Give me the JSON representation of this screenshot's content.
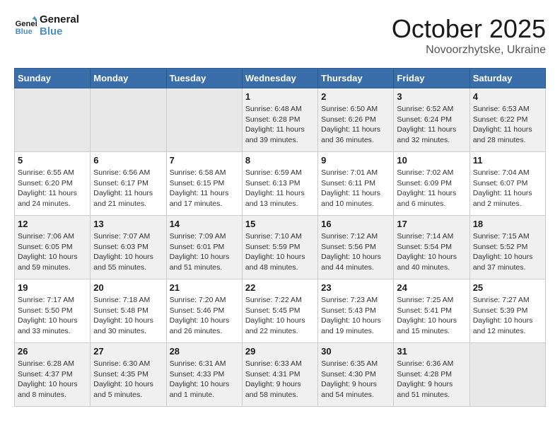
{
  "logo": {
    "line1": "General",
    "line2": "Blue"
  },
  "title": "October 2025",
  "subtitle": "Novoorzhytske, Ukraine",
  "weekdays": [
    "Sunday",
    "Monday",
    "Tuesday",
    "Wednesday",
    "Thursday",
    "Friday",
    "Saturday"
  ],
  "weeks": [
    [
      {
        "day": "",
        "info": ""
      },
      {
        "day": "",
        "info": ""
      },
      {
        "day": "",
        "info": ""
      },
      {
        "day": "1",
        "info": "Sunrise: 6:48 AM\nSunset: 6:28 PM\nDaylight: 11 hours\nand 39 minutes."
      },
      {
        "day": "2",
        "info": "Sunrise: 6:50 AM\nSunset: 6:26 PM\nDaylight: 11 hours\nand 36 minutes."
      },
      {
        "day": "3",
        "info": "Sunrise: 6:52 AM\nSunset: 6:24 PM\nDaylight: 11 hours\nand 32 minutes."
      },
      {
        "day": "4",
        "info": "Sunrise: 6:53 AM\nSunset: 6:22 PM\nDaylight: 11 hours\nand 28 minutes."
      }
    ],
    [
      {
        "day": "5",
        "info": "Sunrise: 6:55 AM\nSunset: 6:20 PM\nDaylight: 11 hours\nand 24 minutes."
      },
      {
        "day": "6",
        "info": "Sunrise: 6:56 AM\nSunset: 6:17 PM\nDaylight: 11 hours\nand 21 minutes."
      },
      {
        "day": "7",
        "info": "Sunrise: 6:58 AM\nSunset: 6:15 PM\nDaylight: 11 hours\nand 17 minutes."
      },
      {
        "day": "8",
        "info": "Sunrise: 6:59 AM\nSunset: 6:13 PM\nDaylight: 11 hours\nand 13 minutes."
      },
      {
        "day": "9",
        "info": "Sunrise: 7:01 AM\nSunset: 6:11 PM\nDaylight: 11 hours\nand 10 minutes."
      },
      {
        "day": "10",
        "info": "Sunrise: 7:02 AM\nSunset: 6:09 PM\nDaylight: 11 hours\nand 6 minutes."
      },
      {
        "day": "11",
        "info": "Sunrise: 7:04 AM\nSunset: 6:07 PM\nDaylight: 11 hours\nand 2 minutes."
      }
    ],
    [
      {
        "day": "12",
        "info": "Sunrise: 7:06 AM\nSunset: 6:05 PM\nDaylight: 10 hours\nand 59 minutes."
      },
      {
        "day": "13",
        "info": "Sunrise: 7:07 AM\nSunset: 6:03 PM\nDaylight: 10 hours\nand 55 minutes."
      },
      {
        "day": "14",
        "info": "Sunrise: 7:09 AM\nSunset: 6:01 PM\nDaylight: 10 hours\nand 51 minutes."
      },
      {
        "day": "15",
        "info": "Sunrise: 7:10 AM\nSunset: 5:59 PM\nDaylight: 10 hours\nand 48 minutes."
      },
      {
        "day": "16",
        "info": "Sunrise: 7:12 AM\nSunset: 5:56 PM\nDaylight: 10 hours\nand 44 minutes."
      },
      {
        "day": "17",
        "info": "Sunrise: 7:14 AM\nSunset: 5:54 PM\nDaylight: 10 hours\nand 40 minutes."
      },
      {
        "day": "18",
        "info": "Sunrise: 7:15 AM\nSunset: 5:52 PM\nDaylight: 10 hours\nand 37 minutes."
      }
    ],
    [
      {
        "day": "19",
        "info": "Sunrise: 7:17 AM\nSunset: 5:50 PM\nDaylight: 10 hours\nand 33 minutes."
      },
      {
        "day": "20",
        "info": "Sunrise: 7:18 AM\nSunset: 5:48 PM\nDaylight: 10 hours\nand 30 minutes."
      },
      {
        "day": "21",
        "info": "Sunrise: 7:20 AM\nSunset: 5:46 PM\nDaylight: 10 hours\nand 26 minutes."
      },
      {
        "day": "22",
        "info": "Sunrise: 7:22 AM\nSunset: 5:45 PM\nDaylight: 10 hours\nand 22 minutes."
      },
      {
        "day": "23",
        "info": "Sunrise: 7:23 AM\nSunset: 5:43 PM\nDaylight: 10 hours\nand 19 minutes."
      },
      {
        "day": "24",
        "info": "Sunrise: 7:25 AM\nSunset: 5:41 PM\nDaylight: 10 hours\nand 15 minutes."
      },
      {
        "day": "25",
        "info": "Sunrise: 7:27 AM\nSunset: 5:39 PM\nDaylight: 10 hours\nand 12 minutes."
      }
    ],
    [
      {
        "day": "26",
        "info": "Sunrise: 6:28 AM\nSunset: 4:37 PM\nDaylight: 10 hours\nand 8 minutes."
      },
      {
        "day": "27",
        "info": "Sunrise: 6:30 AM\nSunset: 4:35 PM\nDaylight: 10 hours\nand 5 minutes."
      },
      {
        "day": "28",
        "info": "Sunrise: 6:31 AM\nSunset: 4:33 PM\nDaylight: 10 hours\nand 1 minute."
      },
      {
        "day": "29",
        "info": "Sunrise: 6:33 AM\nSunset: 4:31 PM\nDaylight: 9 hours\nand 58 minutes."
      },
      {
        "day": "30",
        "info": "Sunrise: 6:35 AM\nSunset: 4:30 PM\nDaylight: 9 hours\nand 54 minutes."
      },
      {
        "day": "31",
        "info": "Sunrise: 6:36 AM\nSunset: 4:28 PM\nDaylight: 9 hours\nand 51 minutes."
      },
      {
        "day": "",
        "info": ""
      }
    ]
  ]
}
